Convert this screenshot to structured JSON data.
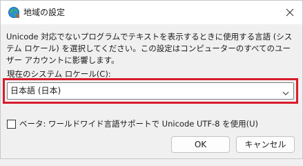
{
  "window": {
    "title": "地域の設定",
    "close_icon": "close-icon",
    "title_icon": "globe-icon"
  },
  "content": {
    "description": "Unicode 対応でないプログラムでテキストを表示するときに使用する言語 (システム ロケール) を選択してください。この設定はコンピューターのすべてのユーザー アカウントに影響します。",
    "locale_label": "現在のシステム ロケール(C):",
    "locale_value": "日本語 (日本)",
    "beta_checkbox_label": "ベータ: ワールドワイド言語サポートで Unicode UTF-8 を使用(U)",
    "beta_checked": false
  },
  "buttons": {
    "ok_label": "OK",
    "cancel_label": "キャンセル"
  },
  "colors": {
    "highlight": "#d81b2c",
    "background": "#f0f0f0"
  }
}
